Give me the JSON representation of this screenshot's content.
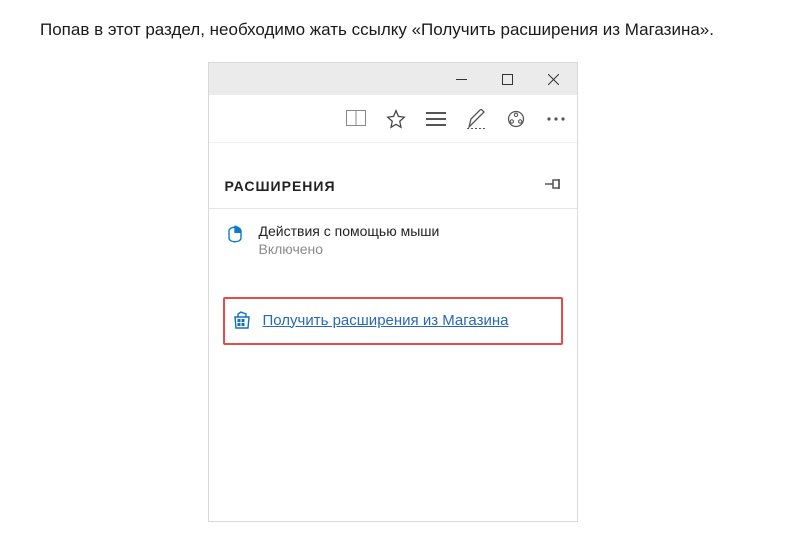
{
  "caption": "Попав в этот раздел, необходимо жать ссылку «Получить расширения из Магазина».",
  "panel": {
    "title": "РАСШИРЕНИЯ"
  },
  "extension": {
    "name": "Действия с помощью мыши",
    "status": "Включено"
  },
  "store": {
    "link_label": "Получить расширения из Магазина"
  }
}
